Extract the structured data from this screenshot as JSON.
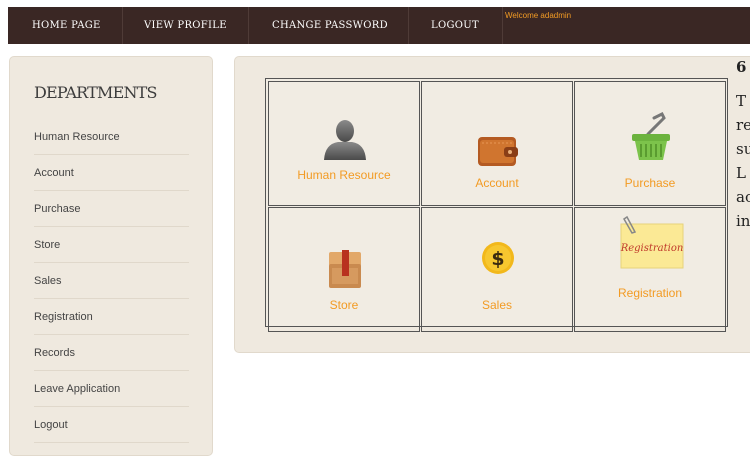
{
  "nav": {
    "items": [
      {
        "label": "HOME PAGE"
      },
      {
        "label": "VIEW PROFILE"
      },
      {
        "label": "CHANGE PASSWORD"
      },
      {
        "label": "LOGOUT"
      }
    ],
    "welcome": "Welcome adadmin"
  },
  "sidebar": {
    "title": "DEPARTMENTS",
    "items": [
      {
        "label": "Human Resource"
      },
      {
        "label": "Account"
      },
      {
        "label": "Purchase"
      },
      {
        "label": "Store"
      },
      {
        "label": "Sales"
      },
      {
        "label": "Registration"
      },
      {
        "label": "Records"
      },
      {
        "label": "Leave Application"
      },
      {
        "label": "Logout"
      }
    ]
  },
  "tiles": [
    {
      "label": "Human Resource",
      "icon": "person-silhouette-icon"
    },
    {
      "label": "Account",
      "icon": "wallet-icon"
    },
    {
      "label": "Purchase",
      "icon": "shopping-basket-icon"
    },
    {
      "label": "Store",
      "icon": "box-icon"
    },
    {
      "label": "Sales",
      "icon": "dollar-coin-icon"
    },
    {
      "label": "Registration",
      "icon": "registration-note-icon",
      "note_text": "Registration"
    }
  ],
  "right_text": [
    "6",
    "T",
    "re",
    "su",
    "L",
    "ac",
    "in"
  ],
  "colors": {
    "nav_bg": "#3a2724",
    "accent": "#f29b24",
    "panel_bg": "#efe9df"
  }
}
